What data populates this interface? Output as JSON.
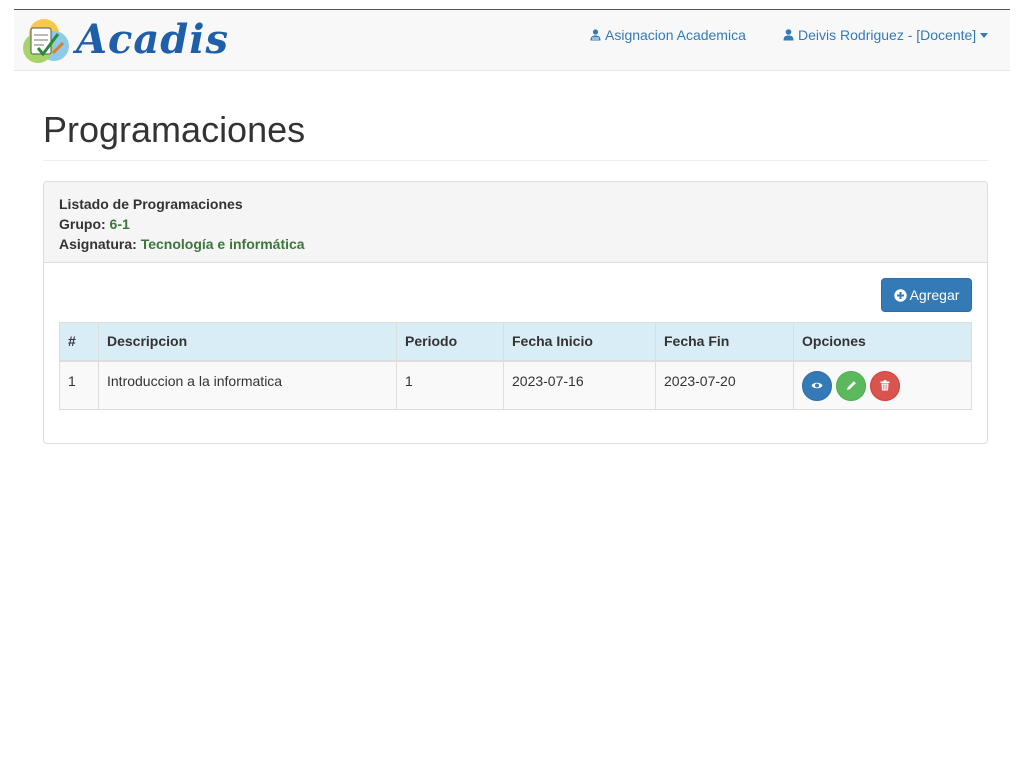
{
  "header": {
    "brand": "Acadis",
    "nav_asignacion": "Asignacion Academica",
    "nav_user": "Deivis Rodriguez - [Docente]"
  },
  "page": {
    "title": "Programaciones"
  },
  "panel": {
    "heading": "Listado de Programaciones",
    "grupo_label": "Grupo:",
    "grupo_value": "6-1",
    "asignatura_label": "Asignatura:",
    "asignatura_value": "Tecnología e informática",
    "add_button": "Agregar"
  },
  "table": {
    "headers": [
      "#",
      "Descripcion",
      "Periodo",
      "Fecha Inicio",
      "Fecha Fin",
      "Opciones"
    ],
    "rows": [
      {
        "num": "1",
        "descripcion": "Introduccion a la informatica",
        "periodo": "1",
        "fecha_inicio": "2023-07-16",
        "fecha_fin": "2023-07-20"
      }
    ]
  },
  "colors": {
    "primary": "#337ab7",
    "success": "#5cb85c",
    "danger": "#d9534f",
    "label_green": "#3c763d",
    "table_header": "#d9edf7"
  },
  "icons": {
    "user_group": "users-icon",
    "user": "user-icon",
    "add": "plus-circle-icon",
    "view": "eye-icon",
    "edit": "pencil-icon",
    "delete": "trash-icon"
  }
}
